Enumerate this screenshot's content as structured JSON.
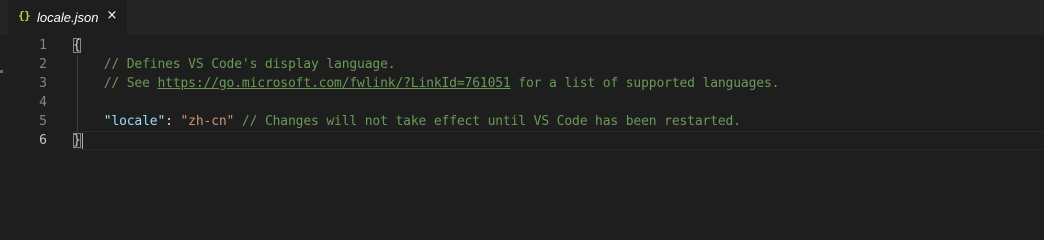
{
  "tab": {
    "icon": "{}",
    "icon_name": "json-braces-icon",
    "label": "locale.json",
    "close": "×"
  },
  "line_numbers": [
    "1",
    "2",
    "3",
    "4",
    "5",
    "6"
  ],
  "active_line": 6,
  "code": {
    "line1": {
      "brace": "{"
    },
    "line2": {
      "comment": "// Defines VS Code's display language."
    },
    "line3": {
      "comment_prefix": "// See ",
      "link": "https://go.microsoft.com/fwlink/?LinkId=761051",
      "comment_suffix": " for a list of supported languages."
    },
    "line5": {
      "key": "\"locale\"",
      "colon": ": ",
      "value": "\"zh-cn\"",
      "comment": " // Changes will not take effect until VS Code has been restarted."
    },
    "line6": {
      "brace": "}"
    }
  },
  "colors": {
    "editor_background": "#1e1e1e",
    "tab_bar_background": "#252526",
    "comment": "#6a9955",
    "json_key": "#9cdcfe",
    "json_string": "#ce9178",
    "json_icon": "#cbcb41"
  }
}
